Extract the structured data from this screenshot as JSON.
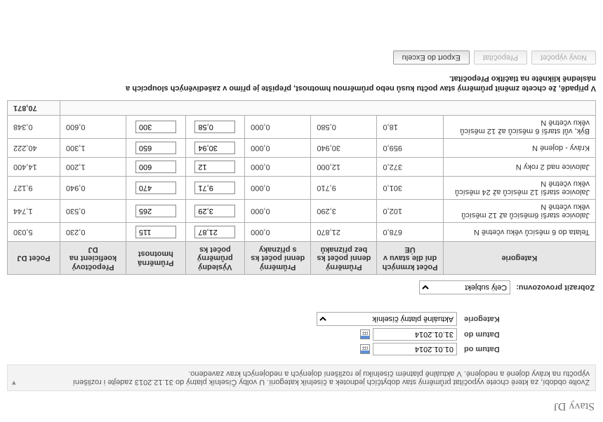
{
  "title": "Stavy DJ",
  "hint": {
    "line1": "Zvolte období, za které chcete vypočítat průměrný stav dobytčích jednotek a číselník kategorií. U volby Číselník platný do 31.12.2013 zadejte i rozlišení",
    "line2": "výpočtu na krávy dojené a nedojené. V aktuálně platném číselníku je rozlišení dojených a nedojených krav zavedeno."
  },
  "form": {
    "datum_od_label": "Datum od",
    "datum_od_value": "01.01.2014",
    "datum_do_label": "Datum do",
    "datum_do_value": "31.01.2014",
    "kategorie_label": "Kategorie",
    "kategorie_value": "Aktuálně platný číselník"
  },
  "provozovna": {
    "label": "Zobrazit provozovnu:",
    "value": "Celý subjekt"
  },
  "columns": {
    "c0": "Kategorie",
    "c1": "Počet krmných dní dle stavu v ÚE",
    "c2": "Průměrný denní počet ks bez příznaků",
    "c3": "Průměrný denní počet ks s příznaky",
    "c4": "Výsledný průměrný počet ks",
    "c5": "Průměrná hmotnost",
    "c6": "Přepočtový koeficient na DJ",
    "c7": "Počet DJ"
  },
  "rows": [
    {
      "cat": "Telata do 6 měsíců věku včetně N",
      "n1": "678,0",
      "n2": "21,870",
      "n3": "0,000",
      "i1": "21,87",
      "i2": "115",
      "n4": "0,230",
      "n5": "5,030"
    },
    {
      "cat": "Jalovice starší 6měsíců až 12 měsíců věku včetně N",
      "n1": "102,0",
      "n2": "3,290",
      "n3": "0,000",
      "i1": "3,29",
      "i2": "265",
      "n4": "0,530",
      "n5": "1,744"
    },
    {
      "cat": "Jalovice starší 12 měsíců až 24 měsíců věku včetně N",
      "n1": "301,0",
      "n2": "9,710",
      "n3": "0,000",
      "i1": "9,71",
      "i2": "470",
      "n4": "0,940",
      "n5": "9,127"
    },
    {
      "cat": "Jalovice nad 2 roky N",
      "n1": "372,0",
      "n2": "12,000",
      "n3": "0,000",
      "i1": "12",
      "i2": "600",
      "n4": "1,200",
      "n5": "14,400"
    },
    {
      "cat": "Krávy - dojené N",
      "n1": "959,0",
      "n2": "30,940",
      "n3": "0,000",
      "i1": "30,94",
      "i2": "650",
      "n4": "1,300",
      "n5": "40,222"
    },
    {
      "cat": "Býk, vůl starší 6 měsíců až 12 měsíců věku včetně N",
      "n1": "18,0",
      "n2": "0,580",
      "n3": "0,000",
      "i1": "0,58",
      "i2": "300",
      "n4": "0,600",
      "n5": "0,348"
    }
  ],
  "total": {
    "label": "",
    "value": "70,871"
  },
  "note": {
    "l1": "V případě, že chcete změnit průměrný stav počtu kusů nebo průměrnou hmotnost, přepište je přímo v zašedivěných sloupcích a",
    "l2": "následně klikněte na tlačítko Přepočítat."
  },
  "buttons": {
    "novy": "Nový výpočet",
    "prepocitat": "Přepočítat",
    "export": "Export do Excelu"
  }
}
